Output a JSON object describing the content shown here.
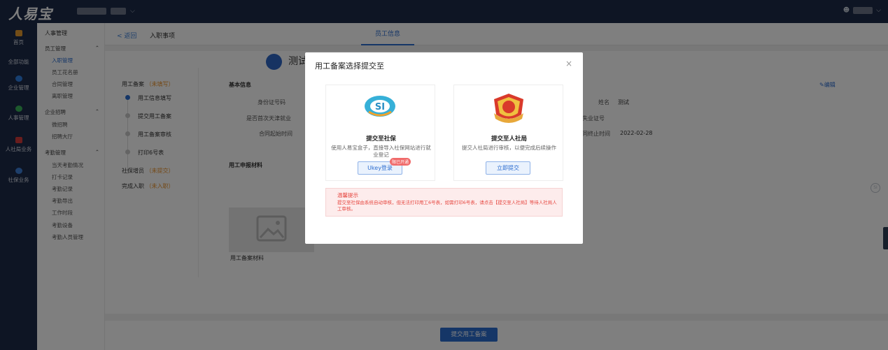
{
  "app": {
    "logo": "人易宝"
  },
  "leftnav": [
    {
      "label": "首页",
      "icon": "home-icon"
    },
    {
      "label": "全部功能",
      "icon": ""
    },
    {
      "label": "企业管理",
      "icon": "enterprise-icon"
    },
    {
      "label": "人事管理",
      "icon": "person-icon"
    },
    {
      "label": "人社局业务",
      "icon": "bureau-icon"
    },
    {
      "label": "社保业务",
      "icon": "social-security-icon"
    }
  ],
  "submenu": {
    "title": "人事管理",
    "groups": [
      {
        "label": "员工管理",
        "items": [
          "入职管理",
          "员工花名册",
          "合同管理",
          "离职管理"
        ]
      },
      {
        "label": "企业招聘",
        "items": [
          "微招聘",
          "招聘大厅"
        ]
      },
      {
        "label": "考勤管理",
        "items": [
          "当天考勤情况",
          "打卡记录",
          "考勤记录",
          "考勤导出",
          "工作时段",
          "考勤设备",
          "考勤人员管理"
        ]
      }
    ]
  },
  "breadcrumb": {
    "back": "< 返回",
    "current": "入职事项",
    "tab": "员工信息"
  },
  "person": {
    "name": "测试"
  },
  "steps": {
    "employment": {
      "label": "用工备案",
      "status": "（未填写）"
    },
    "substeps": [
      "用工信息填写",
      "提交用工备案",
      "用工备案审核",
      "打印6号表"
    ],
    "social": {
      "label": "社保增员",
      "status": "（未提交）"
    },
    "done": {
      "label": "完成入职",
      "status": "（未入职）"
    }
  },
  "info": {
    "section": "基本信息",
    "edit": "编辑",
    "id_label": "身份证号码",
    "first_label": "是否首次天津就业",
    "start_label": "合同起始时间",
    "name_label": "姓名",
    "name_value": "测试",
    "unemp_label": "失业证号",
    "end_label": "同终止时间",
    "end_value": "2022-02-28",
    "materials": "用工申报材料",
    "material_caption": "用工备案材料"
  },
  "footer": {
    "submit": "提交用工备案"
  },
  "modal": {
    "title": "用工备案选择提交至",
    "close": "×",
    "cards": [
      {
        "title": "提交至社保",
        "desc": "使用人易宝盒子，直接导入社保网站进行就业登记",
        "button": "Ukey登录",
        "tag": "限已开通"
      },
      {
        "title": "提交至人社局",
        "desc": "提交人社局进行审核，以便完成后续操作",
        "button": "立即提交"
      }
    ],
    "warning_title": "温馨提示",
    "warning_text": "提交至社保由系统自动审核，但无法打印用工6号表，如需打印6号表，请点击【提交至人社局】等待人社局人工审核。"
  },
  "colors": {
    "topbar": "#1d2b48",
    "primary": "#2b6ccf",
    "warning": "#e6463f"
  }
}
